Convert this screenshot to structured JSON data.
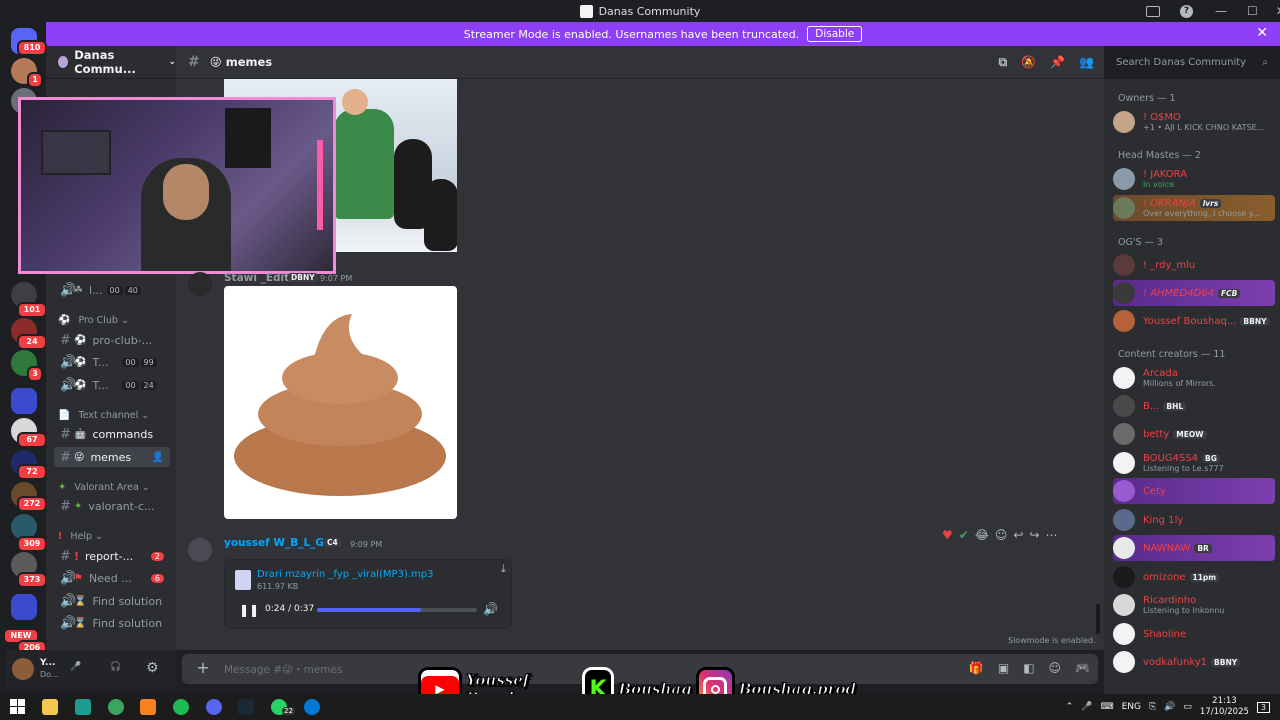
{
  "window": {
    "title": "Danas Community"
  },
  "banner": {
    "text": "Streamer Mode is enabled. Usernames have been truncated.",
    "disable_label": "Disable"
  },
  "server": {
    "name": "Danas Commu..."
  },
  "guild_badges": [
    {
      "label": "810"
    },
    {
      "label": "1"
    },
    {
      "label": "101"
    },
    {
      "label": "24"
    },
    {
      "label": "3"
    },
    {
      "label": "67"
    },
    {
      "label": "72"
    },
    {
      "label": "272"
    },
    {
      "label": "309"
    },
    {
      "label": "373"
    },
    {
      "label": "NEW"
    },
    {
      "label": "206"
    }
  ],
  "channels": {
    "top": {
      "label": "l...",
      "count_a": "00",
      "count_b": "40"
    },
    "cat_pro_club": "Pro Club",
    "pro_club_items": [
      {
        "label": "pro-club-..."
      },
      {
        "label": "T...",
        "count_a": "00",
        "count_b": "99"
      },
      {
        "label": "T...",
        "count_a": "00",
        "count_b": "24"
      }
    ],
    "cat_text": "Text channel",
    "commands": "commands",
    "memes": "memes",
    "cat_valorant": "Valorant Area",
    "valorant": "valorant-c...",
    "cat_help": "Help",
    "report": {
      "label": "report-...",
      "badge": "2"
    },
    "need": {
      "label": "Need ...",
      "badge": "6"
    },
    "find1": "Find solution",
    "find2": "Find solution"
  },
  "chat": {
    "channel_name": "memes",
    "prev_author": "Stawi _Edit",
    "prev_tag": "DBNY",
    "prev_time": "9:07 PM",
    "author": "youssef W_B_L_G",
    "author_tag": "C4",
    "time": "9:09 PM",
    "attachment": {
      "filename": "Drari mzayrin _fyp _viral(MP3).mp3",
      "size": "611.97 KB",
      "time": "0:24 / 0:37",
      "progress": 0.65
    },
    "slowmode": "Slowmode is enabled.",
    "input_placeholder": "Message #😜・memes"
  },
  "search": {
    "placeholder": "Search Danas Community"
  },
  "members": {
    "cat_owners": "Owners — 1",
    "cat_head": "Head Mastes — 2",
    "cat_og": "OG'S — 3",
    "cat_content": "Content creators — 11",
    "list": [
      {
        "name": "! O$MO",
        "sub": "+1 • AJI L KICK CHNO KATSE..."
      },
      {
        "name": "! JAKORA",
        "sub": "In voice"
      },
      {
        "name": "! OKRANJA",
        "sub": "Over everything, I choose y...",
        "tag": "lvrs"
      },
      {
        "name": "! _rdy_mlu",
        "sub": ""
      },
      {
        "name": "! AHMED4D64",
        "sub": "",
        "tag": "FCB"
      },
      {
        "name": "Youssef Boushaq...",
        "sub": "",
        "tag": "BBNY"
      },
      {
        "name": "Arcada",
        "sub": "Millions of Mirrors."
      },
      {
        "name": "B...",
        "sub": "",
        "tag": "BHL"
      },
      {
        "name": "betty",
        "sub": "",
        "tag": "MEOW"
      },
      {
        "name": "BOUG4SS4",
        "sub": "Listening to Le.s777",
        "tag": "BG"
      },
      {
        "name": "Cety",
        "sub": ""
      },
      {
        "name": "King 1ly",
        "sub": ""
      },
      {
        "name": "NAWNAW",
        "sub": "",
        "tag": "BR"
      },
      {
        "name": "omizone",
        "sub": "",
        "tag": "11pm"
      },
      {
        "name": "Ricardinho",
        "sub": "Listening to Inkonnu"
      },
      {
        "name": "Shaoline",
        "sub": ""
      },
      {
        "name": "vodkafunky1",
        "sub": "",
        "tag": "BBNY"
      }
    ]
  },
  "user": {
    "name": "Y...",
    "status": "Do..."
  },
  "taskbar": {
    "lang": "ENG",
    "time": "21:13",
    "date": "17/10/2025",
    "whatsapp_badge": "22",
    "notif": "3"
  },
  "overlay": {
    "youtube": "Youssef Boushaq",
    "kick": "Boushaq",
    "instagram": "Boushaq.prod"
  },
  "colors": {
    "accent": "#5865f2",
    "banner": "#8c3ff5",
    "name_red": "#f23f43",
    "link": "#00a8fc"
  }
}
